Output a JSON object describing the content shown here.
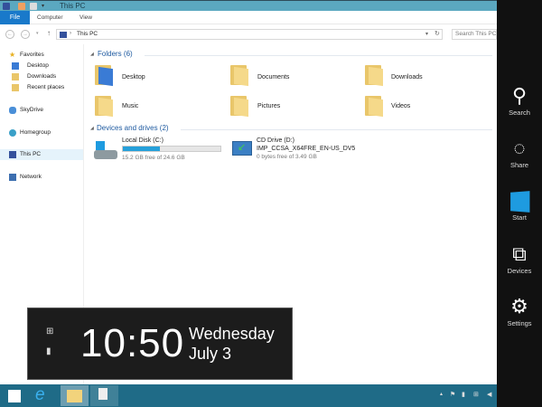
{
  "window": {
    "title": "This PC"
  },
  "ribbon": {
    "tabs": [
      "File",
      "Computer",
      "View"
    ]
  },
  "address": {
    "path": "This PC",
    "search_placeholder": "Search This PC"
  },
  "nav": {
    "favorites": "Favorites",
    "desktop": "Desktop",
    "downloads": "Downloads",
    "recent": "Recent places",
    "skydrive": "SkyDrive",
    "homegroup": "Homegroup",
    "thispc": "This PC",
    "network": "Network"
  },
  "folders": {
    "header": "Folders (6)",
    "items": [
      "Desktop",
      "Documents",
      "Downloads",
      "Music",
      "Pictures",
      "Videos"
    ]
  },
  "drives": {
    "header": "Devices and drives (2)",
    "items": [
      {
        "name": "Local Disk (C:)",
        "free": "15.2 GB free of 24.6 GB",
        "used_fraction": 0.38
      },
      {
        "name": "CD Drive (D:)",
        "label": "IMP_CCSA_X64FRE_EN-US_DV5",
        "free": "0 bytes free of 3.49 GB"
      }
    ]
  },
  "charms": [
    "Search",
    "Share",
    "Start",
    "Devices",
    "Settings"
  ],
  "clock": {
    "time": "10:50",
    "day": "Wednesday",
    "date": "July 3"
  }
}
